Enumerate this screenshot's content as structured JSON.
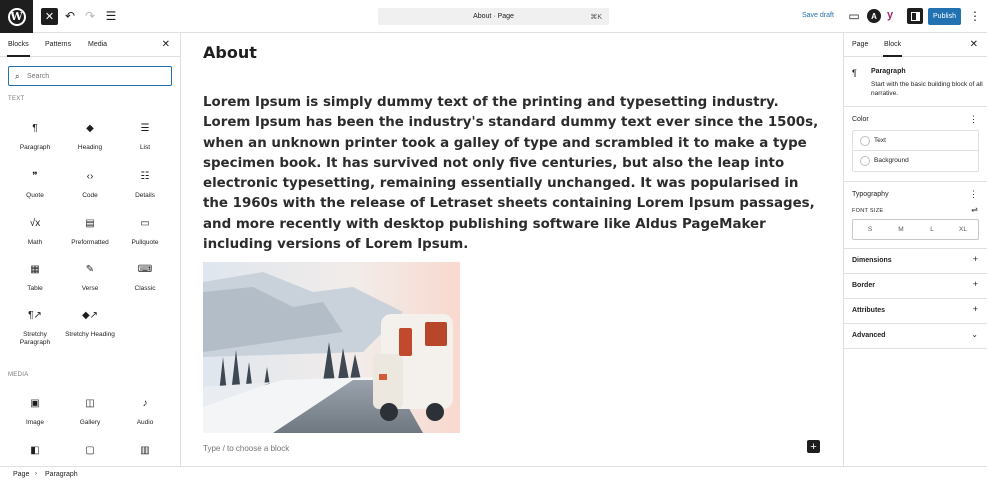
{
  "topbar": {
    "logo_letter": "W",
    "document_title": "About · Page",
    "shortcut": "⌘K",
    "save_draft": "Save draft",
    "publish": "Publish",
    "yoast_label": "y"
  },
  "inserter": {
    "tabs": [
      "Blocks",
      "Patterns",
      "Media"
    ],
    "active_tab": "Blocks",
    "search_placeholder": "Search",
    "categories": [
      {
        "name": "TEXT",
        "blocks": [
          {
            "label": "Paragraph",
            "icon": "paragraph-icon",
            "glyph": "¶"
          },
          {
            "label": "Heading",
            "icon": "heading-bookmark-icon",
            "glyph": "🔖"
          },
          {
            "label": "List",
            "icon": "list-icon",
            "glyph": "☰"
          },
          {
            "label": "Quote",
            "icon": "quote-icon",
            "glyph": "❞"
          },
          {
            "label": "Code",
            "icon": "code-icon",
            "glyph": "‹›"
          },
          {
            "label": "Details",
            "icon": "details-icon",
            "glyph": "☷"
          },
          {
            "label": "Math",
            "icon": "math-icon",
            "glyph": "√x"
          },
          {
            "label": "Preformatted",
            "icon": "preformatted-icon",
            "glyph": "▤"
          },
          {
            "label": "Pullquote",
            "icon": "pullquote-icon",
            "glyph": "▭"
          },
          {
            "label": "Table",
            "icon": "table-icon",
            "glyph": "▦"
          },
          {
            "label": "Verse",
            "icon": "verse-icon",
            "glyph": "✎"
          },
          {
            "label": "Classic",
            "icon": "keyboard-icon",
            "glyph": "⌨"
          },
          {
            "label": "Stretchy Paragraph",
            "icon": "stretchy-paragraph-icon",
            "glyph": "¶↗"
          },
          {
            "label": "Stretchy Heading",
            "icon": "stretchy-heading-icon",
            "glyph": "🔖↗"
          }
        ]
      },
      {
        "name": "MEDIA",
        "blocks": [
          {
            "label": "Image",
            "icon": "image-icon",
            "glyph": "▣"
          },
          {
            "label": "Gallery",
            "icon": "gallery-icon",
            "glyph": "◫"
          },
          {
            "label": "Audio",
            "icon": "audio-icon",
            "glyph": "♪"
          }
        ]
      }
    ]
  },
  "editor": {
    "page_title": "About",
    "paragraph": "Lorem Ipsum is simply dummy text of the printing and typesetting industry. Lorem Ipsum has been the industry's standard dummy text ever since the 1500s, when an unknown printer took a galley of type and scrambled it to make a type specimen book. It has survived not only five centuries, but also the leap into electronic typesetting, remaining essentially unchanged. It was popularised in the 1960s with the release of Letraset sheets containing Lorem Ipsum passages, and more recently with desktop publishing software like Aldus PageMaker including versions of Lorem Ipsum.",
    "block_placeholder": "Type / to choose a block"
  },
  "settings": {
    "tabs": [
      "Page",
      "Block"
    ],
    "active_tab": "Block",
    "block_name": "Paragraph",
    "block_description": "Start with the basic building block of all narrative.",
    "color": {
      "title": "Color",
      "items": [
        "Text",
        "Background"
      ]
    },
    "typography": {
      "title": "Typography",
      "font_size_label": "FONT SIZE",
      "sizes": [
        "S",
        "M",
        "L",
        "XL"
      ]
    },
    "panels": [
      "Dimensions",
      "Border",
      "Attributes",
      "Advanced"
    ]
  },
  "breadcrumb": [
    "Page",
    "Paragraph"
  ],
  "colors": {
    "accent": "#2271b1",
    "dark": "#1e1e1e",
    "border": "#e0e0e0"
  }
}
